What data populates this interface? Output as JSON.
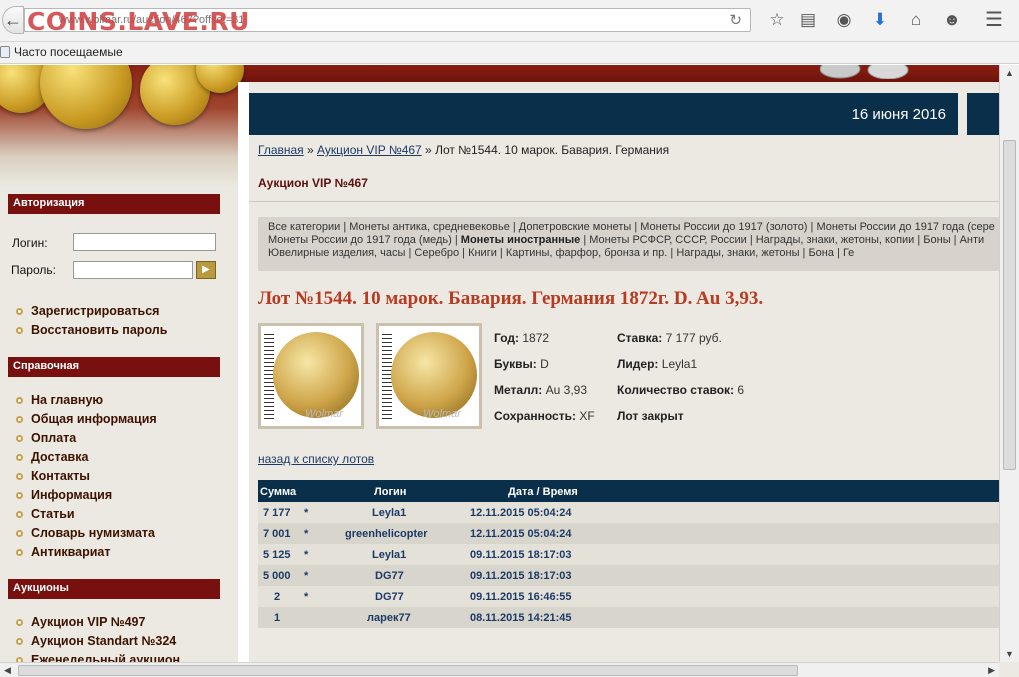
{
  "browser": {
    "url": "www.wolmar.ru/auction/467?offset=31",
    "watermark": "COINS.LAVE.RU",
    "bookmark_label": "Часто посещаемые"
  },
  "header": {
    "date": "16 июня 2016"
  },
  "sidebar": {
    "auth_heading": "Авторизация",
    "login_label": "Логин:",
    "password_label": "Пароль:",
    "auth_links": [
      "Зарегистрироваться",
      "Восстановить пароль"
    ],
    "ref_heading": "Справочная",
    "ref_links": [
      "На главную",
      "Общая информация",
      "Оплата",
      "Доставка",
      "Контакты",
      "Информация",
      "Статьи",
      "Словарь нумизмата",
      "Антиквариат"
    ],
    "auctions_heading": "Аукционы",
    "auction_links": [
      "Аукцион VIP №497",
      "Аукцион Standart №324",
      "Еженедельный аукцион"
    ]
  },
  "breadcrumb": {
    "home": "Главная",
    "auction": "Аукцион VIP №467",
    "current": "Лот №1544. 10 марок. Бавария. Германия"
  },
  "auction_title": "Аукцион VIP №467",
  "categories": {
    "line1": "Все категории | Монеты антика, средневековье | Допетровские монеты | Монеты России до 1917 (золото) | Монеты России до 1917 года (сере",
    "line2_a": "Монеты России до 1917 года (медь) | ",
    "line2_bold": "Монеты иностранные",
    "line2_b": " | Монеты РСФСР, СССР, России | Награды, знаки, жетоны, копии | Боны | Анти",
    "line3": "Ювелирные изделия, часы | Серебро | Книги | Картины, фарфор, бронза и пр. | Награды, знаки, жетоны | Бона | Ге"
  },
  "lot": {
    "title": "Лот №1544.  10 марок. Бавария. Германия 1872г. D. Au 3,93.",
    "photo_watermark": "Wolmar",
    "year_label": "Год:",
    "year": "1872",
    "letters_label": "Буквы:",
    "letters": "D",
    "metal_label": "Металл:",
    "metal": "Au 3,93",
    "grade_label": "Сохранность:",
    "grade": "XF",
    "bid_label": "Ставка:",
    "bid": "7 177 руб.",
    "leader_label": "Лидер:",
    "leader": "Leyla1",
    "bids_count_label": "Количество ставок:",
    "bids_count": "6",
    "status": "Лот закрыт"
  },
  "back_link": "назад к списку лотов",
  "bids_table": {
    "headers": [
      "Сумма",
      "Логин",
      "Дата / Время"
    ],
    "rows": [
      {
        "sum": "7 177",
        "auto": "*",
        "login": "Leyla1",
        "datetime": "12.11.2015 05:04:24"
      },
      {
        "sum": "7 001",
        "auto": "*",
        "login": "greenhelicopter",
        "datetime": "12.11.2015 05:04:24"
      },
      {
        "sum": "5 125",
        "auto": "*",
        "login": "Leyla1",
        "datetime": "09.11.2015 18:17:03"
      },
      {
        "sum": "5 000",
        "auto": "*",
        "login": "DG77",
        "datetime": "09.11.2015 18:17:03"
      },
      {
        "sum": "2",
        "auto": "*",
        "login": "DG77",
        "datetime": "09.11.2015 16:46:55"
      },
      {
        "sum": "1",
        "auto": "",
        "login": "ларек77",
        "datetime": "08.11.2015 14:21:45"
      }
    ]
  }
}
